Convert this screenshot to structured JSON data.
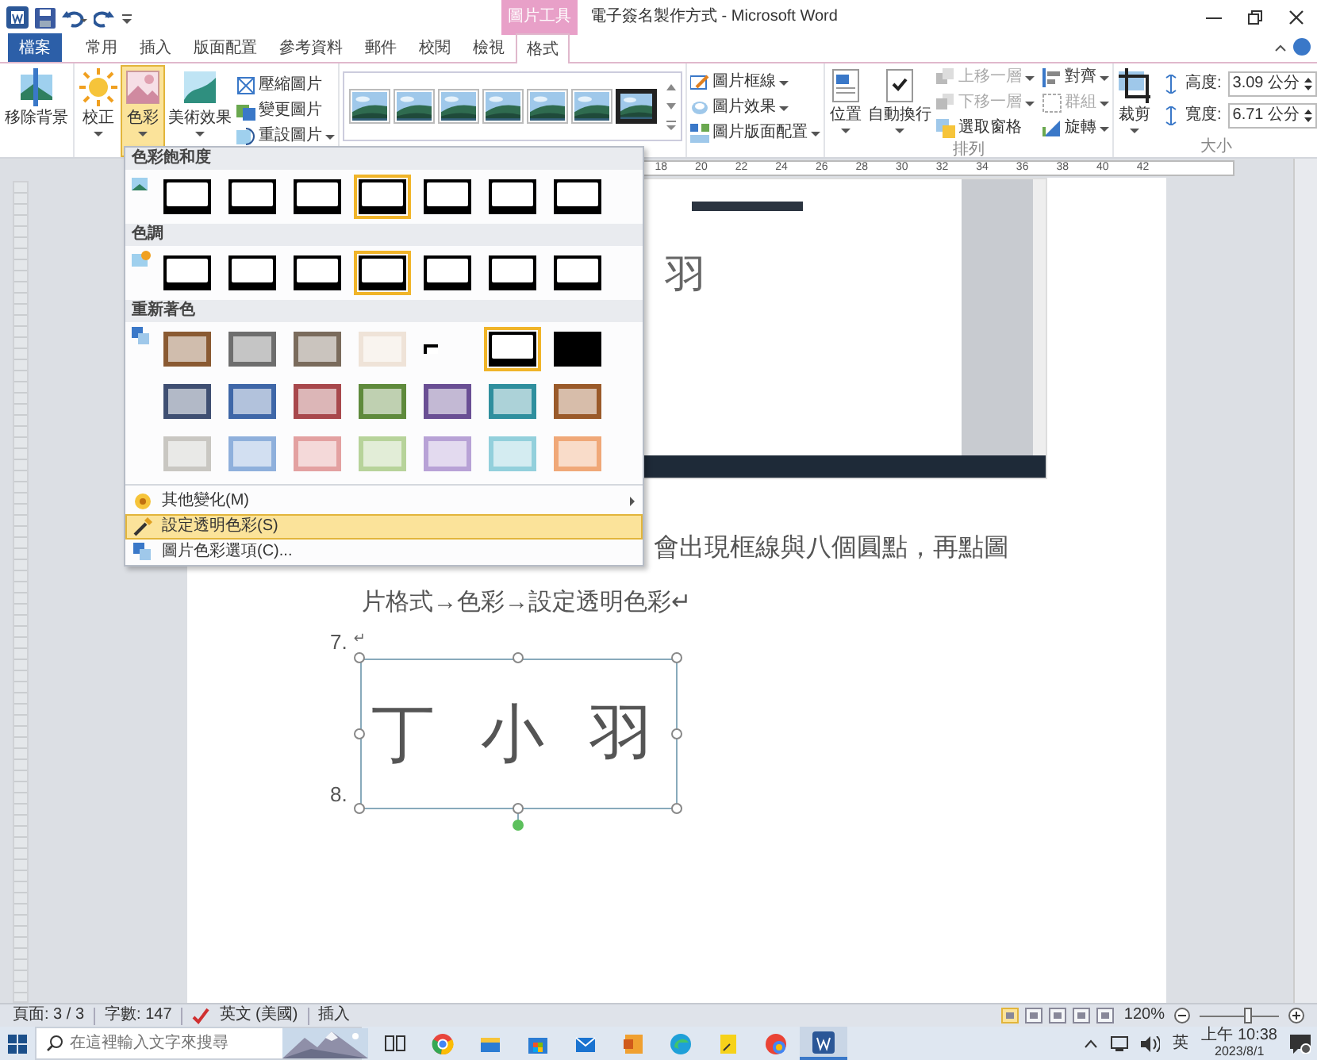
{
  "title_bar": {
    "contextual_tab": "圖片工具",
    "title": "電子簽名製作方式 - Microsoft Word"
  },
  "tabs": [
    {
      "label": "檔案",
      "kind": "file",
      "selected": false
    },
    {
      "label": "常用",
      "kind": "normal",
      "selected": false
    },
    {
      "label": "插入",
      "kind": "normal",
      "selected": false
    },
    {
      "label": "版面配置",
      "kind": "normal",
      "selected": false
    },
    {
      "label": "參考資料",
      "kind": "normal",
      "selected": false
    },
    {
      "label": "郵件",
      "kind": "normal",
      "selected": false
    },
    {
      "label": "校閱",
      "kind": "normal",
      "selected": false
    },
    {
      "label": "檢視",
      "kind": "normal",
      "selected": false
    },
    {
      "label": "格式",
      "kind": "contextual",
      "selected": true
    }
  ],
  "ribbon": {
    "adjust": [
      {
        "label": "移除背景",
        "dropdown": false,
        "pressed": false
      },
      {
        "label": "校正",
        "dropdown": true,
        "pressed": false
      },
      {
        "label": "色彩",
        "dropdown": true,
        "pressed": true
      },
      {
        "label": "美術效果",
        "dropdown": true,
        "pressed": false
      }
    ],
    "adjust_small": [
      {
        "label": "壓縮圖片",
        "dropdown": false
      },
      {
        "label": "變更圖片",
        "dropdown": false
      },
      {
        "label": "重設圖片",
        "dropdown": true
      }
    ],
    "picture_styles": [
      {
        "kind": "plain"
      },
      {
        "kind": "plain"
      },
      {
        "kind": "plain"
      },
      {
        "kind": "plain"
      },
      {
        "kind": "plain"
      },
      {
        "kind": "plain"
      },
      {
        "kind": "dark-frame"
      }
    ],
    "picture_format": [
      {
        "label": "圖片框線",
        "dropdown": true
      },
      {
        "label": "圖片效果",
        "dropdown": true
      },
      {
        "label": "圖片版面配置",
        "dropdown": true
      }
    ],
    "arrange": {
      "large": [
        {
          "label": "位置",
          "dropdown": true
        },
        {
          "label": "自動換行",
          "dropdown": true
        }
      ],
      "small": [
        {
          "label": "上移一層",
          "dropdown": true,
          "disabled": true
        },
        {
          "label": "下移一層",
          "dropdown": true,
          "disabled": true
        },
        {
          "label": "選取窗格",
          "dropdown": false,
          "disabled": false
        },
        {
          "label": "對齊",
          "dropdown": true,
          "disabled": false
        },
        {
          "label": "群組",
          "dropdown": true,
          "disabled": true
        },
        {
          "label": "旋轉",
          "dropdown": true,
          "disabled": false
        }
      ],
      "group_label": "排列"
    },
    "size": {
      "crop": "裁剪",
      "height_label": "高度:",
      "height": "3.09 公分",
      "width_label": "寬度:",
      "width": "6.71 公分",
      "group_label": "大小"
    }
  },
  "color_menu": {
    "sections": [
      {
        "title": "色彩飽和度",
        "options": [
          {
            "selected": false
          },
          {
            "selected": false
          },
          {
            "selected": false
          },
          {
            "selected": true
          },
          {
            "selected": false
          },
          {
            "selected": false
          },
          {
            "selected": false
          }
        ]
      },
      {
        "title": "色調",
        "options": [
          {
            "selected": false
          },
          {
            "selected": false
          },
          {
            "selected": false
          },
          {
            "selected": true
          },
          {
            "selected": false
          },
          {
            "selected": false
          },
          {
            "selected": false
          }
        ]
      },
      {
        "title": "重新著色",
        "options": [
          {
            "kind": "tint",
            "color": "#8a5a32",
            "selected": false
          },
          {
            "kind": "tint",
            "color": "#6e6e6e",
            "selected": false
          },
          {
            "kind": "tint",
            "color": "#7a6b5c",
            "selected": false
          },
          {
            "kind": "tint",
            "color": "#efe3d8",
            "selected": false
          },
          {
            "kind": "corners",
            "color": "#000000",
            "selected": false
          },
          {
            "kind": "framed",
            "color": "#000000",
            "selected": true
          },
          {
            "kind": "solid",
            "color": "#000000",
            "selected": false
          },
          {
            "kind": "tint",
            "color": "#3f4f72",
            "selected": false
          },
          {
            "kind": "tint",
            "color": "#3f67a8",
            "selected": false
          },
          {
            "kind": "tint",
            "color": "#a8484c",
            "selected": false
          },
          {
            "kind": "tint",
            "color": "#5f8a3c",
            "selected": false
          },
          {
            "kind": "tint",
            "color": "#6a4f94",
            "selected": false
          },
          {
            "kind": "tint",
            "color": "#2f8f9e",
            "selected": false
          },
          {
            "kind": "tint",
            "color": "#9a5a2a",
            "selected": false
          },
          {
            "kind": "tint",
            "color": "#c9c7c2",
            "selected": false
          },
          {
            "kind": "tint",
            "color": "#8fb0dc",
            "selected": false
          },
          {
            "kind": "tint",
            "color": "#e3a1a1",
            "selected": false
          },
          {
            "kind": "tint",
            "color": "#b7d39a",
            "selected": false
          },
          {
            "kind": "tint",
            "color": "#b8a2d6",
            "selected": false
          },
          {
            "kind": "tint",
            "color": "#93d0dc",
            "selected": false
          },
          {
            "kind": "tint",
            "color": "#f0a878",
            "selected": false
          }
        ]
      }
    ],
    "items": [
      {
        "label": "其他變化(M)",
        "submenu": true,
        "selected": false
      },
      {
        "label": "設定透明色彩(S)",
        "submenu": false,
        "selected": true
      },
      {
        "label": "圖片色彩選項(C)...",
        "submenu": false,
        "selected": false
      }
    ]
  },
  "document": {
    "ruler": [
      "18",
      "20",
      "22",
      "24",
      "26",
      "28",
      "30",
      "32",
      "34",
      "36",
      "38",
      "40",
      "42"
    ],
    "embedded_screenshot": {
      "text": "羽"
    },
    "paragraphs": [
      "會出現框線與八個圓點，再點圖",
      "片格式→色彩→設定透明色彩↵"
    ],
    "list": [
      {
        "number": "7.",
        "mark": "↵"
      },
      {
        "number": "8."
      }
    ],
    "signature": {
      "text": "丁 小 羽",
      "selected": true
    }
  },
  "status_bar": {
    "page": "頁面: 3 / 3",
    "words": "字數: 147",
    "language": "英文 (美國)",
    "mode": "插入",
    "views": [
      {
        "selected": true
      },
      {
        "selected": false
      },
      {
        "selected": false
      },
      {
        "selected": false
      },
      {
        "selected": false
      }
    ],
    "zoom": "120%",
    "zoom_slider": {
      "level": 0.6
    }
  },
  "taskbar": {
    "search_placeholder": "在這裡輸入文字來搜尋",
    "apps": [
      {
        "selected": false
      },
      {
        "selected": false
      },
      {
        "selected": false
      },
      {
        "selected": false
      },
      {
        "selected": false
      },
      {
        "selected": false
      },
      {
        "selected": false
      },
      {
        "selected": false
      },
      {
        "selected": false
      },
      {
        "selected": true
      }
    ],
    "ime": "英",
    "time": "上午 10:38",
    "date": "2023/8/1"
  }
}
